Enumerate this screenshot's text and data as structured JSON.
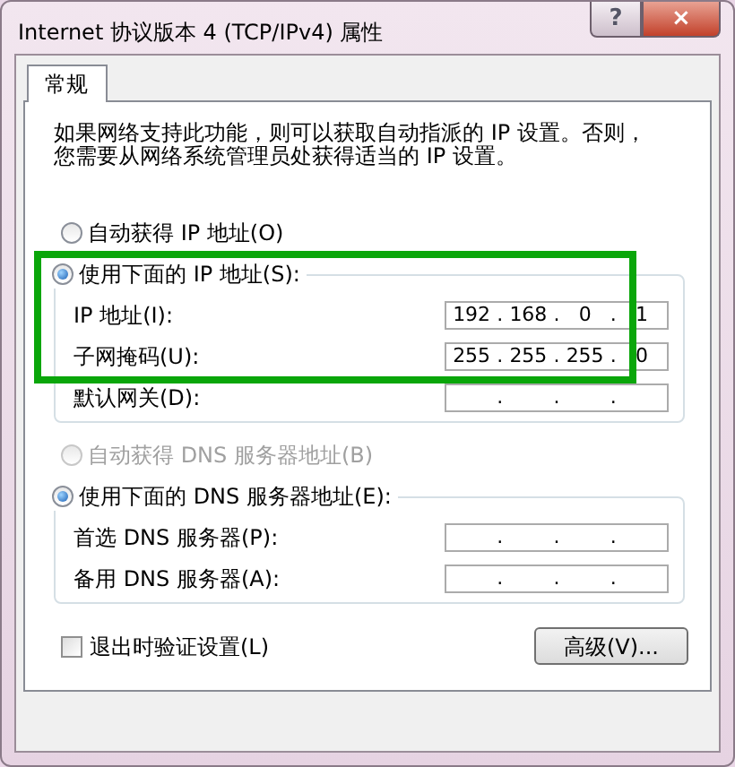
{
  "window": {
    "title": "Internet 协议版本 4 (TCP/IPv4) 属性",
    "help_button": "?",
    "close_button": "×"
  },
  "tabs": [
    {
      "label": "常规",
      "selected": true
    }
  ],
  "description": "如果网络支持此功能，则可以获取自动指派的 IP 设置。否则，您需要从网络系统管理员处获得适当的 IP 设置。",
  "ip_section": {
    "options": [
      {
        "label": "自动获得 IP 地址(O)",
        "selected": false,
        "disabled": false
      },
      {
        "label": "使用下面的 IP 地址(S):",
        "selected": true,
        "disabled": false
      }
    ],
    "fields": [
      {
        "label": "IP 地址(I):",
        "octets": [
          "192",
          "168",
          "0",
          "1"
        ],
        "separators": [
          ".",
          ".",
          "."
        ],
        "disabled": false
      },
      {
        "label": "子网掩码(U):",
        "octets": [
          "255",
          "255",
          "255",
          "0"
        ],
        "separators": [
          ".",
          ".",
          "."
        ],
        "disabled": false
      },
      {
        "label": "默认网关(D):",
        "separators": [
          ".",
          ".",
          "."
        ],
        "disabled": false
      }
    ]
  },
  "dns_section": {
    "options": [
      {
        "label": "自动获得 DNS 服务器地址(B)",
        "selected": false,
        "disabled": true
      },
      {
        "label": "使用下面的 DNS 服务器地址(E):",
        "selected": true,
        "disabled": false
      }
    ],
    "fields": [
      {
        "label": "首选 DNS 服务器(P):",
        "separators": [
          ".",
          ".",
          "."
        ],
        "disabled": false
      },
      {
        "label": "备用 DNS 服务器(A):",
        "separators": [
          ".",
          ".",
          "."
        ],
        "disabled": false
      }
    ]
  },
  "validate_checkbox": {
    "label": "退出时验证设置(L)",
    "checked": false
  },
  "advanced_button": "高级(V)...",
  "highlight": {
    "color": "#0aa60a"
  }
}
